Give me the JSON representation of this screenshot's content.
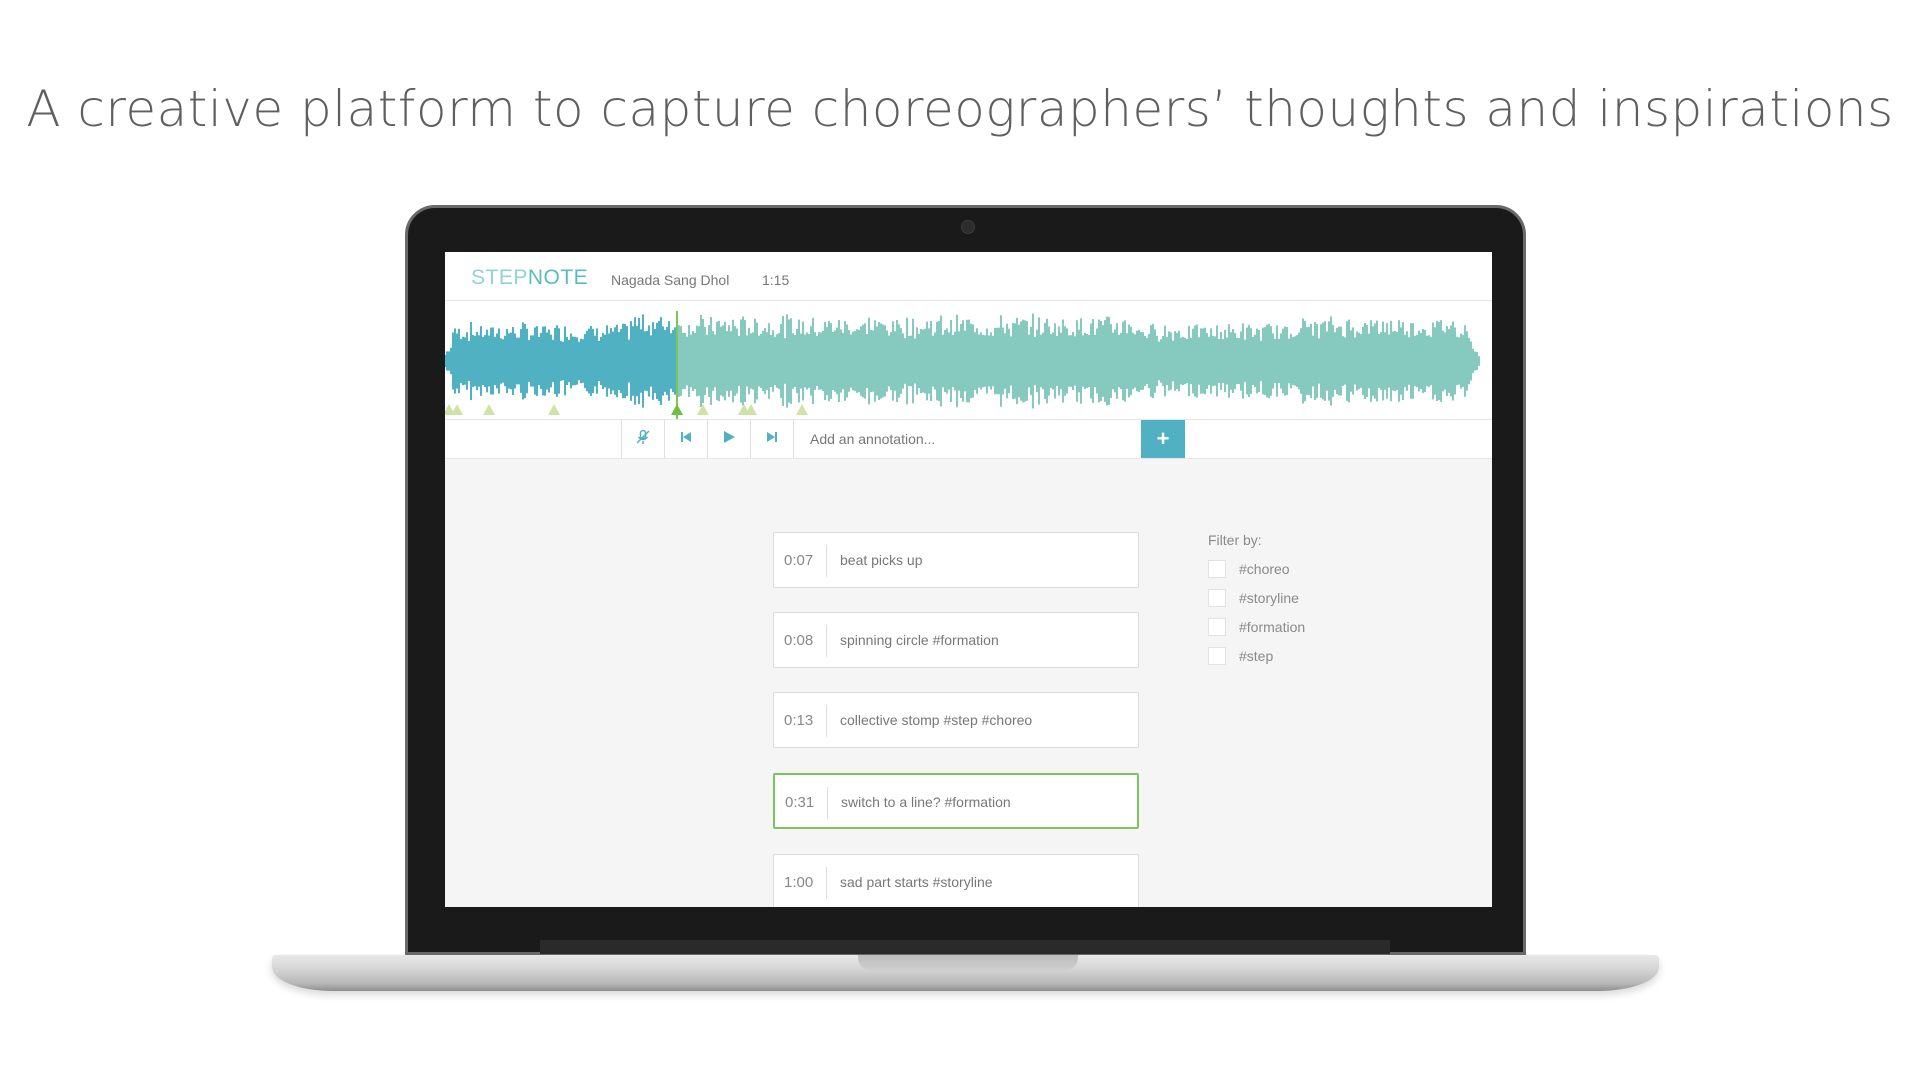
{
  "headline": "A creative platform to capture choreographers’ thoughts and inspirations",
  "app": {
    "logo_light": "STEP",
    "logo_bold": "NOTE",
    "song_title": "Nagada Sang Dhol",
    "song_duration": "1:15",
    "accent_color": "#5bbcc0",
    "played_color": "#4fb1c2",
    "wave_color": "#86c9be",
    "active_color": "#7cc55c"
  },
  "controls": {
    "mic_icon": "mic-off-icon",
    "prev_icon": "skip-back-icon",
    "play_icon": "play-icon",
    "next_icon": "skip-forward-icon",
    "annotation_placeholder": "Add an annotation...",
    "add_label": "+"
  },
  "notes": [
    {
      "time": "0:07",
      "text": "beat picks up",
      "active": false
    },
    {
      "time": "0:08",
      "text": "spinning circle #formation",
      "active": false
    },
    {
      "time": "0:13",
      "text": "collective stomp #step #choreo",
      "active": false
    },
    {
      "time": "0:31",
      "text": "switch to a line? #formation",
      "active": true
    },
    {
      "time": "1:00",
      "text": "sad part starts #storyline",
      "active": false
    }
  ],
  "filter": {
    "label": "Filter by:",
    "tags": [
      "#choreo",
      "#storyline",
      "#formation",
      "#step"
    ]
  }
}
